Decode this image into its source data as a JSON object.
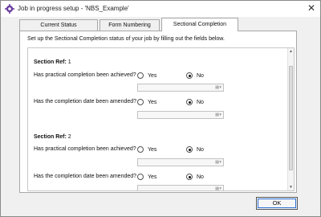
{
  "window": {
    "title": "Job in progress setup - 'NBS_Example'",
    "close_glyph": "✕",
    "app_icon": "gear-icon"
  },
  "tabs": [
    {
      "label": "Current Status",
      "active": false
    },
    {
      "label": "Form Numbering",
      "active": false
    },
    {
      "label": "Sectional Completion",
      "active": true
    }
  ],
  "intro_text": "Set up the Sectional Completion status of your job by filling out the fields below.",
  "sections": [
    {
      "ref_label": "Section Ref:",
      "ref_value": "1",
      "q_practical": "Has practical completion been achieved?",
      "q_amended": "Has the completion date been amended?",
      "opt_yes": "Yes",
      "opt_no": "No",
      "practical_selected": "No",
      "amended_selected": "No",
      "practical_date": "",
      "amended_date": ""
    },
    {
      "ref_label": "Section Ref:",
      "ref_value": "2",
      "q_practical": "Has practical completion been achieved?",
      "q_amended": "Has the completion date been amended?",
      "opt_yes": "Yes",
      "opt_no": "No",
      "practical_selected": "No",
      "amended_selected": "No",
      "practical_date": "",
      "amended_date": ""
    }
  ],
  "date_field_icons": "▦▾",
  "ok_label": "OK",
  "colors": {
    "focus": "#2b6cd6"
  }
}
